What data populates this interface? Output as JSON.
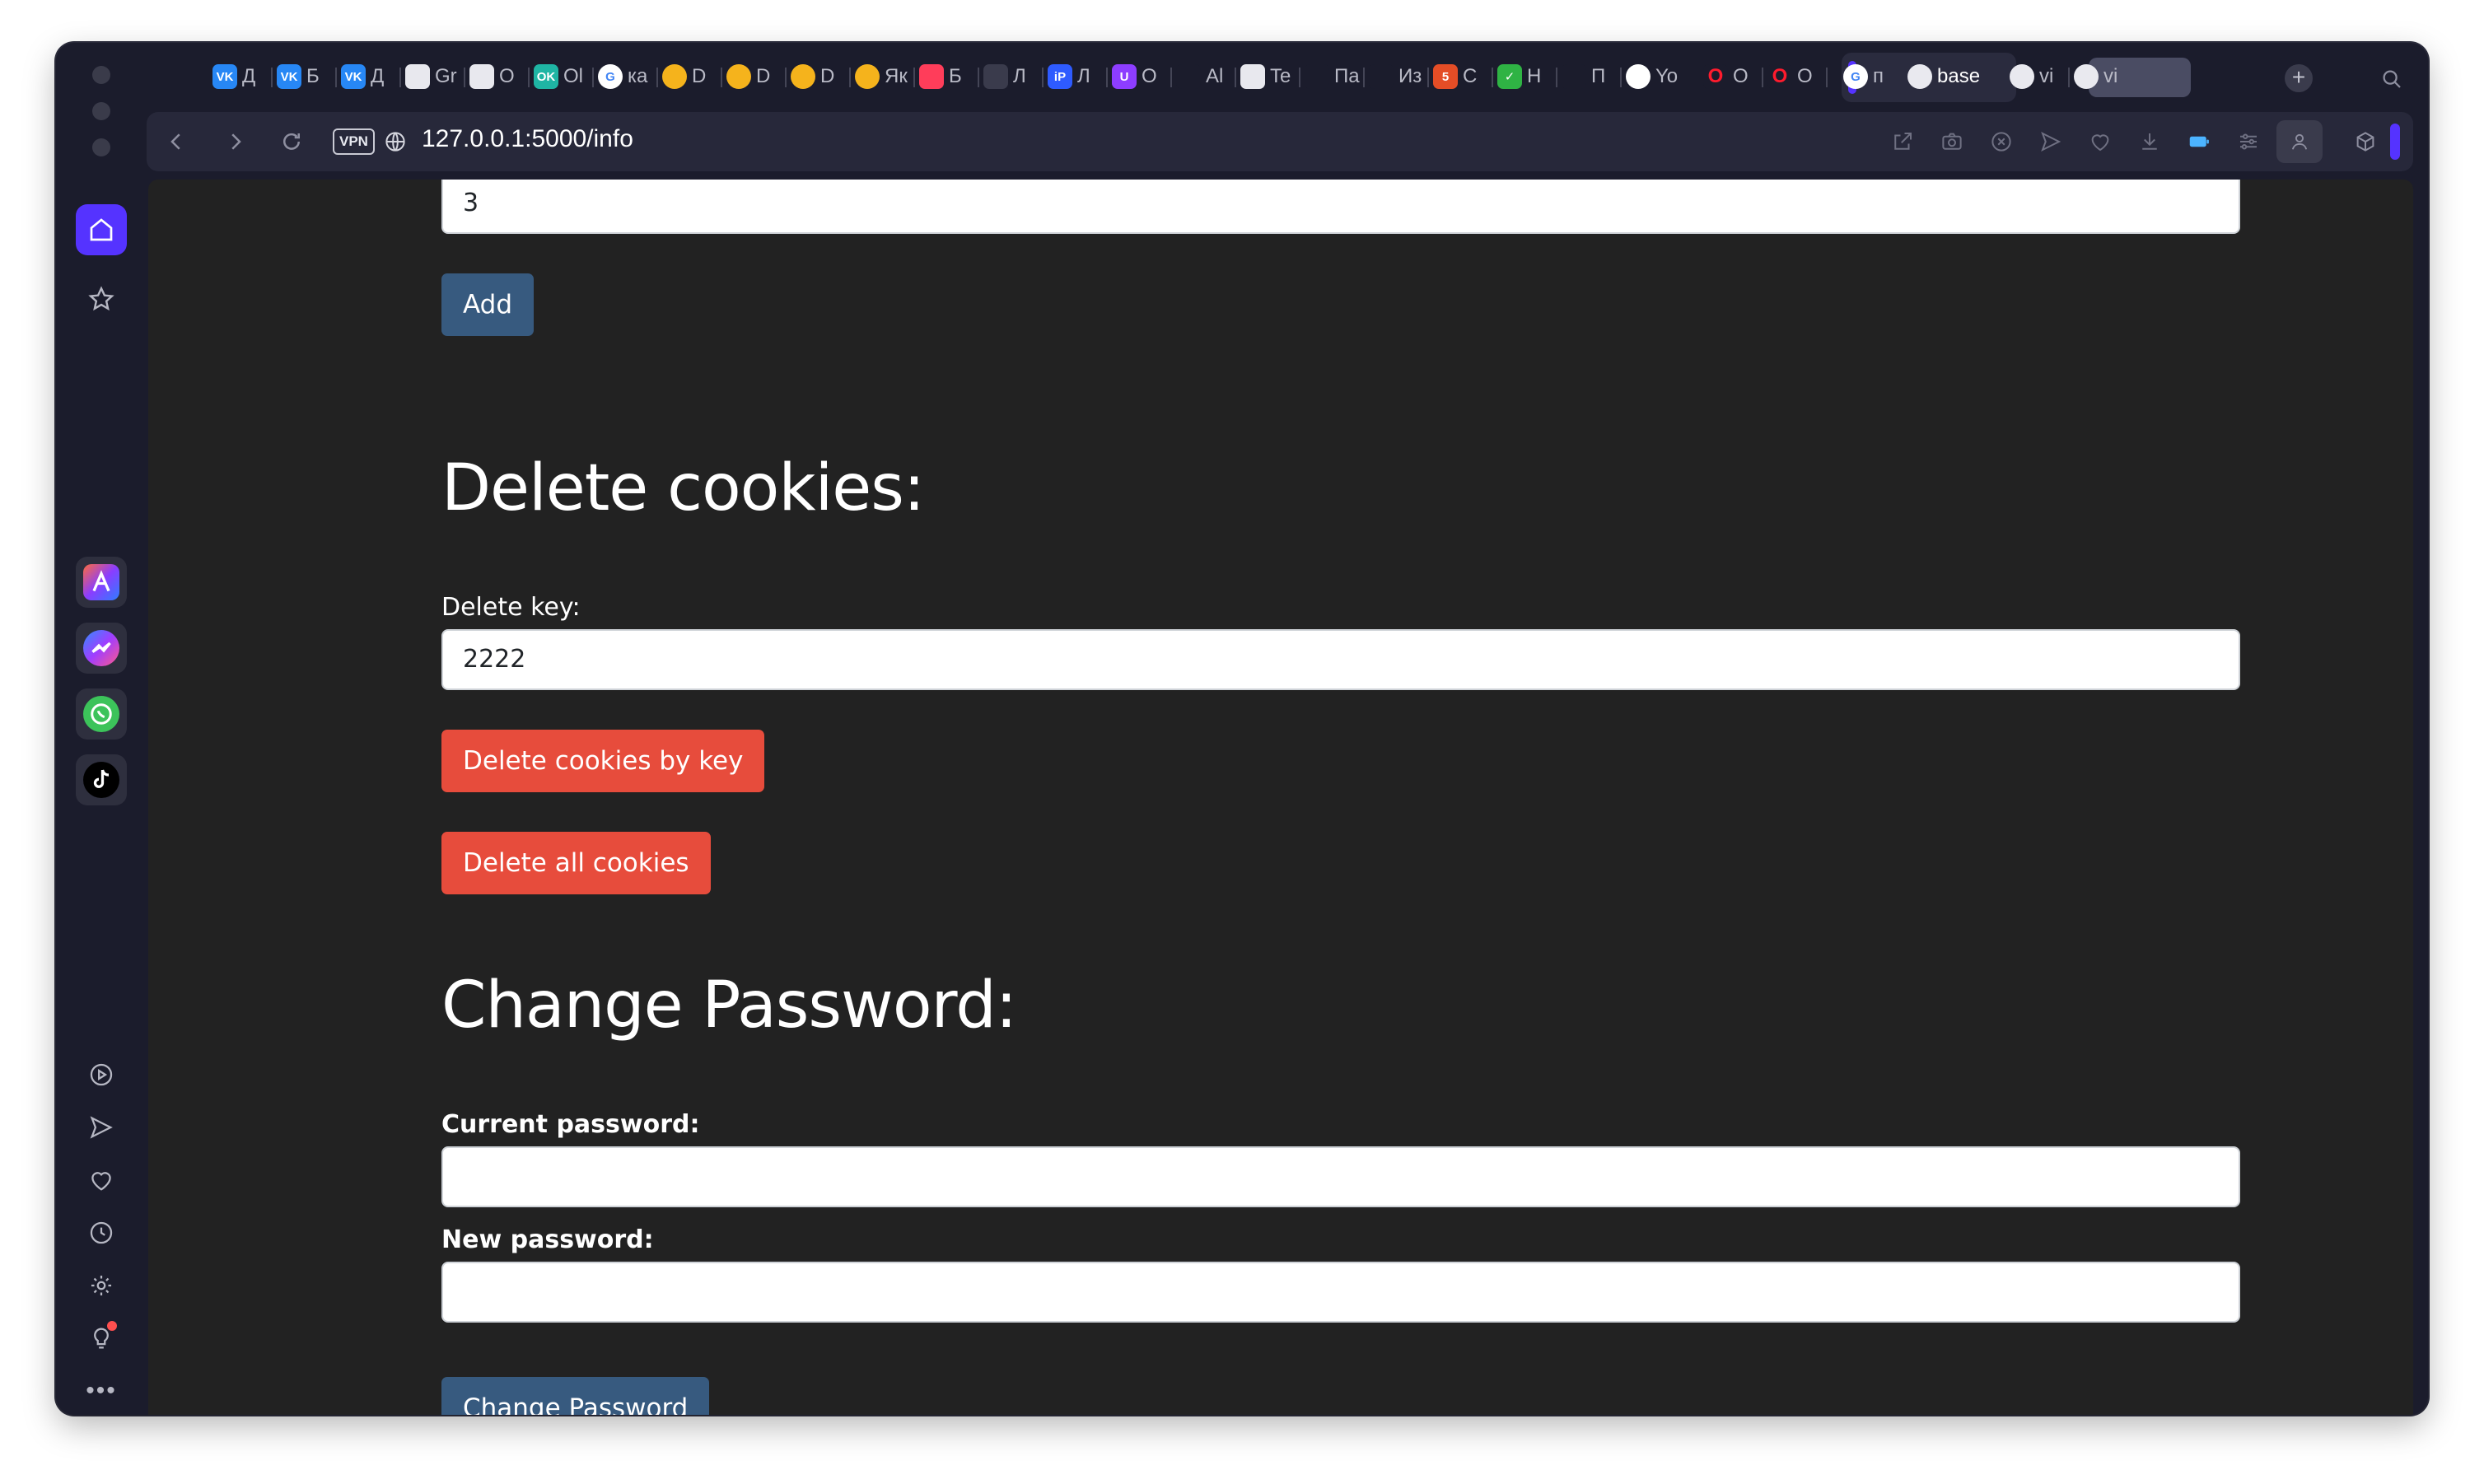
{
  "browser": {
    "address": "127.0.0.1:5000/info",
    "vpn_label": "VPN",
    "tabs": [
      {
        "label": "Д",
        "icon": "vk-icon"
      },
      {
        "label": "Б",
        "icon": "vk-icon"
      },
      {
        "label": "Д",
        "icon": "vk-icon"
      },
      {
        "label": "Gr",
        "icon": "document-icon"
      },
      {
        "label": "О",
        "icon": "document-icon"
      },
      {
        "label": "Ol",
        "icon": "ok-icon"
      },
      {
        "label": "ка",
        "icon": "google-icon"
      },
      {
        "label": "D",
        "icon": "sun-icon"
      },
      {
        "label": "D",
        "icon": "sun-icon"
      },
      {
        "label": "D",
        "icon": "sun-icon"
      },
      {
        "label": "Як",
        "icon": "sun-icon"
      },
      {
        "label": "Б",
        "icon": "flame-icon"
      },
      {
        "label": "Л",
        "icon": "bulb-icon"
      },
      {
        "label": "Л",
        "icon": "ip-icon"
      },
      {
        "label": "O",
        "icon": "shield-icon"
      },
      {
        "label": "Al",
        "icon": "slash-icon"
      },
      {
        "label": "Te",
        "icon": "document-icon"
      },
      {
        "label": "Па",
        "icon": "gear-icon"
      },
      {
        "label": "Из",
        "icon": "slash-icon"
      },
      {
        "label": "C",
        "icon": "html5-icon"
      },
      {
        "label": "H",
        "icon": "check-icon"
      },
      {
        "label": "П",
        "icon": "money-icon"
      },
      {
        "label": "Yo",
        "icon": "github-icon"
      },
      {
        "label": "O",
        "icon": "opera-icon"
      },
      {
        "label": "O",
        "icon": "opera-icon"
      },
      {
        "label": "п",
        "icon": "google-icon"
      },
      {
        "label": "base",
        "icon": "globe-icon"
      },
      {
        "label": "vi",
        "icon": "globe-icon"
      },
      {
        "label": "vi",
        "icon": "globe-icon"
      }
    ],
    "active_tab_index": 26,
    "colors": {
      "accent": "#5533ff",
      "page_bg": "#222222"
    }
  },
  "page": {
    "add_section": {
      "input_value": "3",
      "add_button": "Add"
    },
    "delete_cookies": {
      "heading": "Delete cookies:",
      "key_label": "Delete key:",
      "key_value": "2222",
      "delete_by_key_button": "Delete cookies by key",
      "delete_all_button": "Delete all cookies"
    },
    "change_password": {
      "heading": "Change Password:",
      "current_label": "Current password:",
      "current_value": "",
      "new_label": "New password:",
      "new_value": "",
      "submit_button": "Change Password"
    }
  }
}
